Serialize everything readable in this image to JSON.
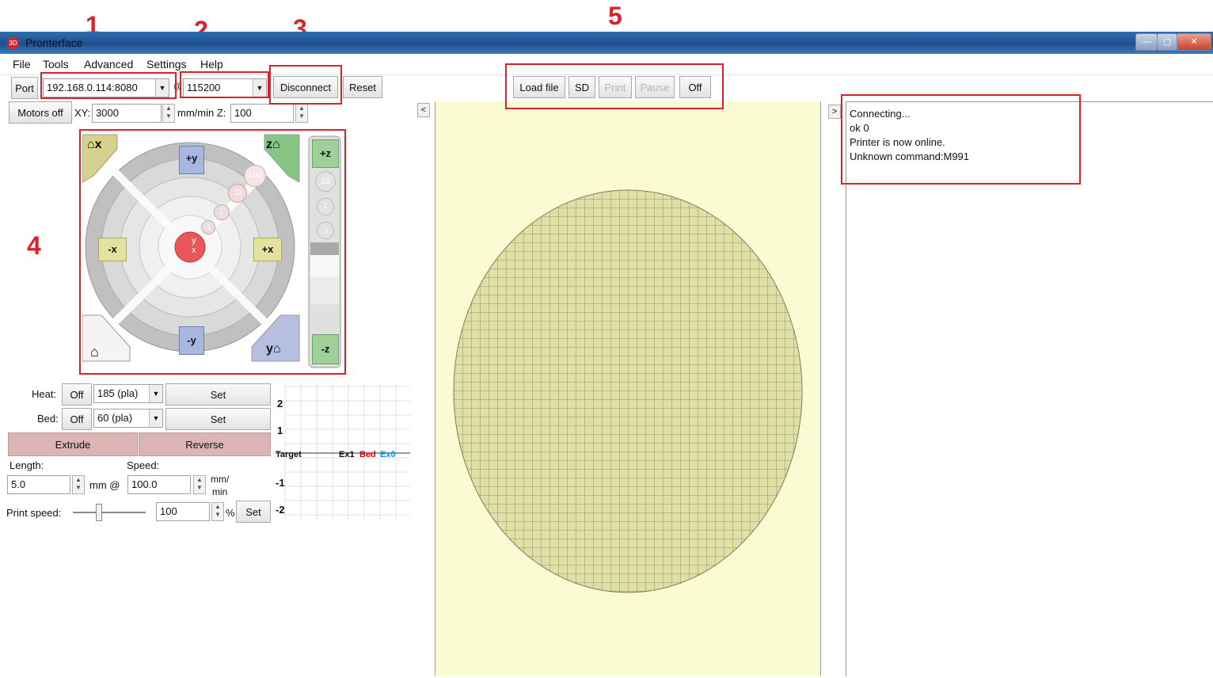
{
  "annotations": [
    "1",
    "2",
    "3",
    "4",
    "5"
  ],
  "window": {
    "title": "Pronterface",
    "icon_text": "3D"
  },
  "window_controls": [
    "—",
    "▢",
    "✕"
  ],
  "menu": [
    "File",
    "Tools",
    "Advanced",
    "Settings",
    "Help"
  ],
  "connection": {
    "port_label": "Port",
    "port_value": "192.168.0.114:8080",
    "at_label": "@",
    "baud_value": "115200",
    "disconnect_label": "Disconnect",
    "reset_label": "Reset"
  },
  "motion": {
    "motors_off_label": "Motors off",
    "xy_label": "XY:",
    "xy_value": "3000",
    "xy_unit": "mm/min Z:",
    "z_value": "100"
  },
  "jog": {
    "home_x": "x",
    "home_z": "z",
    "plus_y": "+y",
    "minus_y": "-y",
    "plus_x": "+x",
    "minus_x": "-x",
    "home_y": "y",
    "plus_z": "+z",
    "minus_z": "-z",
    "step_100": "100",
    "step_10": "10",
    "step_1": "1",
    "step_01": ".1",
    "z_step_10": "10",
    "z_step_1": "1",
    "z_step_01": ".1",
    "center_y": "y",
    "center_x": "x"
  },
  "toolbar": {
    "load_file": "Load file",
    "sd": "SD",
    "print": "Print",
    "pause": "Pause",
    "off": "Off"
  },
  "temps": {
    "heat_label": "Heat:",
    "heat_off": "Off",
    "heat_value": "185 (pla)",
    "heat_set": "Set",
    "bed_label": "Bed:",
    "bed_off": "Off",
    "bed_value": "60 (pla)",
    "bed_set": "Set"
  },
  "extrude": {
    "extrude_label": "Extrude",
    "reverse_label": "Reverse",
    "length_label": "Length:",
    "speed_label": "Speed:",
    "length_value": "5.0",
    "mm_at": "mm @",
    "speed_value": "100.0",
    "speed_unit_1": "mm/",
    "speed_unit_2": "min"
  },
  "print_speed": {
    "label": "Print speed:",
    "value": "100",
    "percent": "%",
    "set": "Set",
    "slider_fraction": 0.35
  },
  "temp_graph": {
    "y_ticks": [
      "2",
      "1",
      "-1",
      "-2"
    ],
    "legend": [
      "Target",
      "Ex1",
      "Bed",
      "Ex0"
    ],
    "legend_colors": [
      "#000000",
      "#000000",
      "#e00000",
      "#00a0e0"
    ]
  },
  "console_lines": [
    "Connecting...",
    "ok 0",
    "Printer is now online.",
    "Unknown command:M991"
  ],
  "colors": {
    "plate": "#fafbd2",
    "bed_disc": "#dfe0a6",
    "grid": "#7d7d5e",
    "annotation": "#d9222a"
  }
}
